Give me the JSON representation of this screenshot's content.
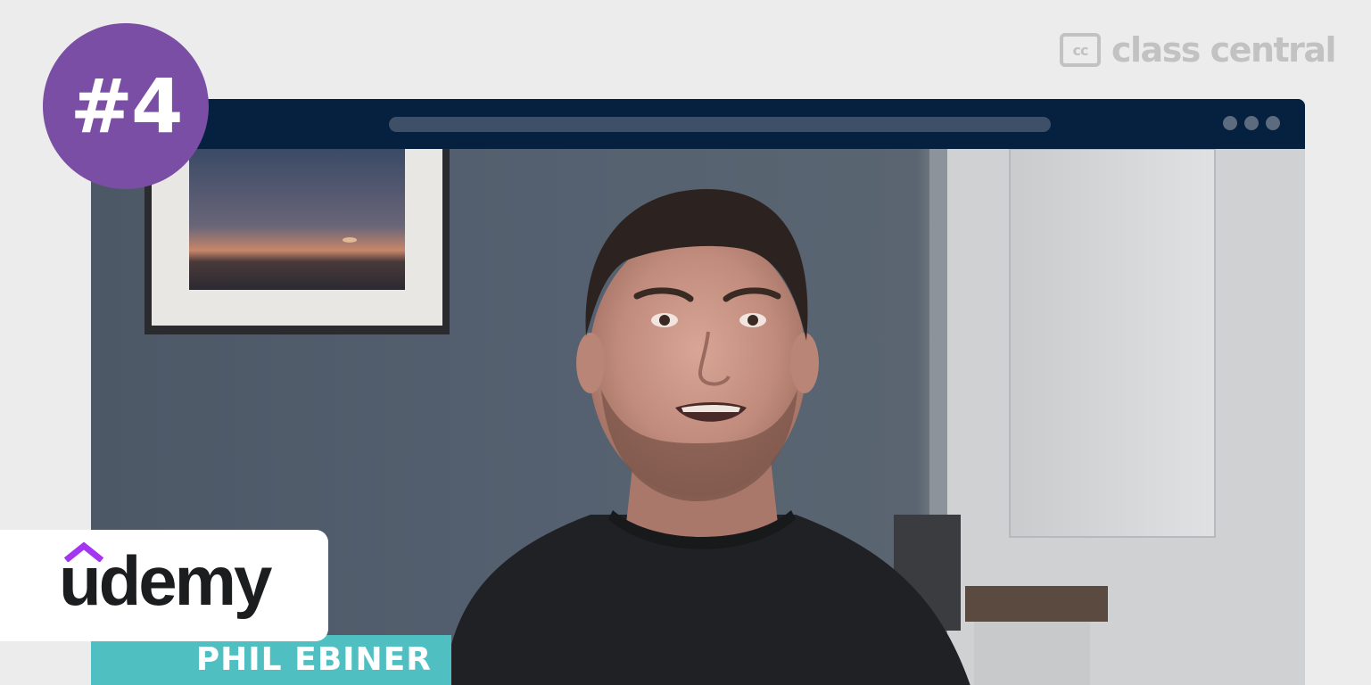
{
  "brand": {
    "icon_label": "cc",
    "name": "class central"
  },
  "badge": {
    "rank_label": "#4"
  },
  "browser": {
    "icons": [
      "window-dot",
      "window-dot",
      "window-dot"
    ]
  },
  "video": {
    "scene": "instructor-video-frame"
  },
  "provider": {
    "name": "udemy",
    "icon": "udemy-hat-icon",
    "accent_color": "#a435f0"
  },
  "instructor": {
    "name": "PHIL EBINER",
    "tag_color": "#4fbfc1"
  },
  "colors": {
    "badge": "#7a4ea5",
    "browser_bar": "#06213f",
    "background": "#ececec"
  }
}
